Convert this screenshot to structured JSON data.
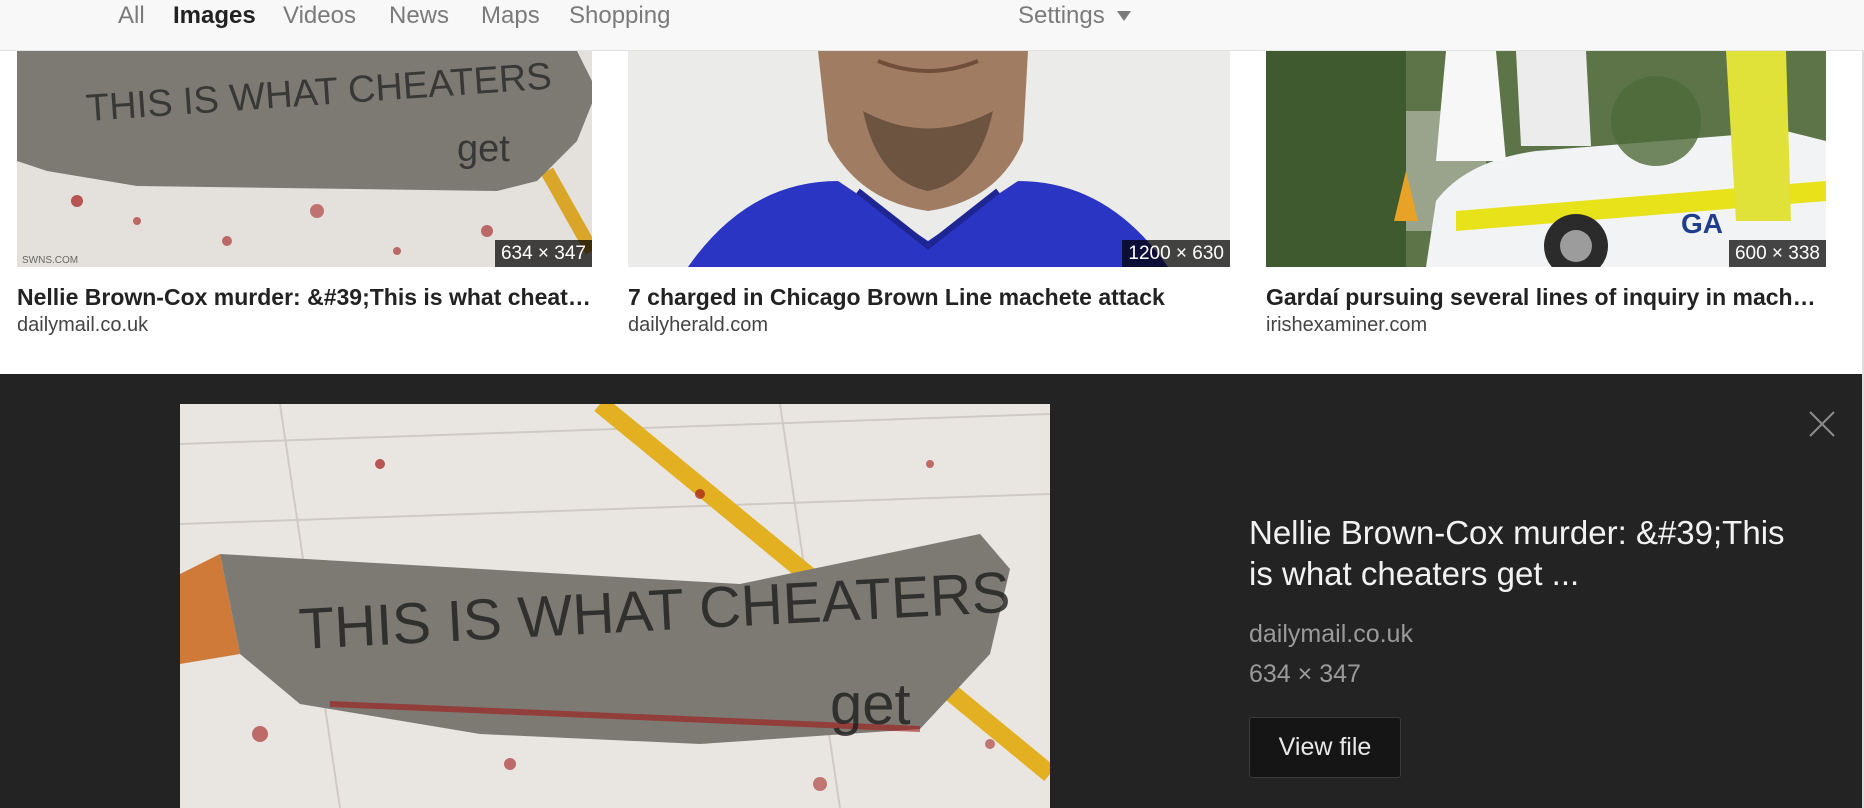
{
  "nav": {
    "tabs": [
      "All",
      "Images",
      "Videos",
      "News",
      "Maps",
      "Shopping"
    ],
    "active_tab": "Images",
    "settings_label": "Settings"
  },
  "results": [
    {
      "title": "Nellie Brown-Cox murder: &#39;This is what cheater...",
      "source": "dailymail.co.uk",
      "dimensions": "634 × 347",
      "watermark": "SWNS.COM"
    },
    {
      "title": "7 charged in Chicago Brown Line machete attack",
      "source": "dailyherald.com",
      "dimensions": "1200 × 630"
    },
    {
      "title": "Gardaí pursuing several lines of inquiry in machete...",
      "source": "irishexaminer.com",
      "dimensions": "600 × 338"
    }
  ],
  "preview": {
    "title": "Nellie Brown-Cox murder: &#39;This is what cheaters get ...",
    "source": "dailymail.co.uk",
    "dimensions": "634 × 347",
    "button_label": "View file",
    "blade_text_line1": "THIS IS WHAT CHEATERS",
    "blade_text_line2": "get"
  },
  "colors": {
    "panel_bg": "#232323",
    "nav_bg": "#f8f8f8",
    "blade": "#7d7a74",
    "blood": "#a11818",
    "police_yellow": "#e8e21a",
    "shirt_blue": "#2b35c4"
  }
}
